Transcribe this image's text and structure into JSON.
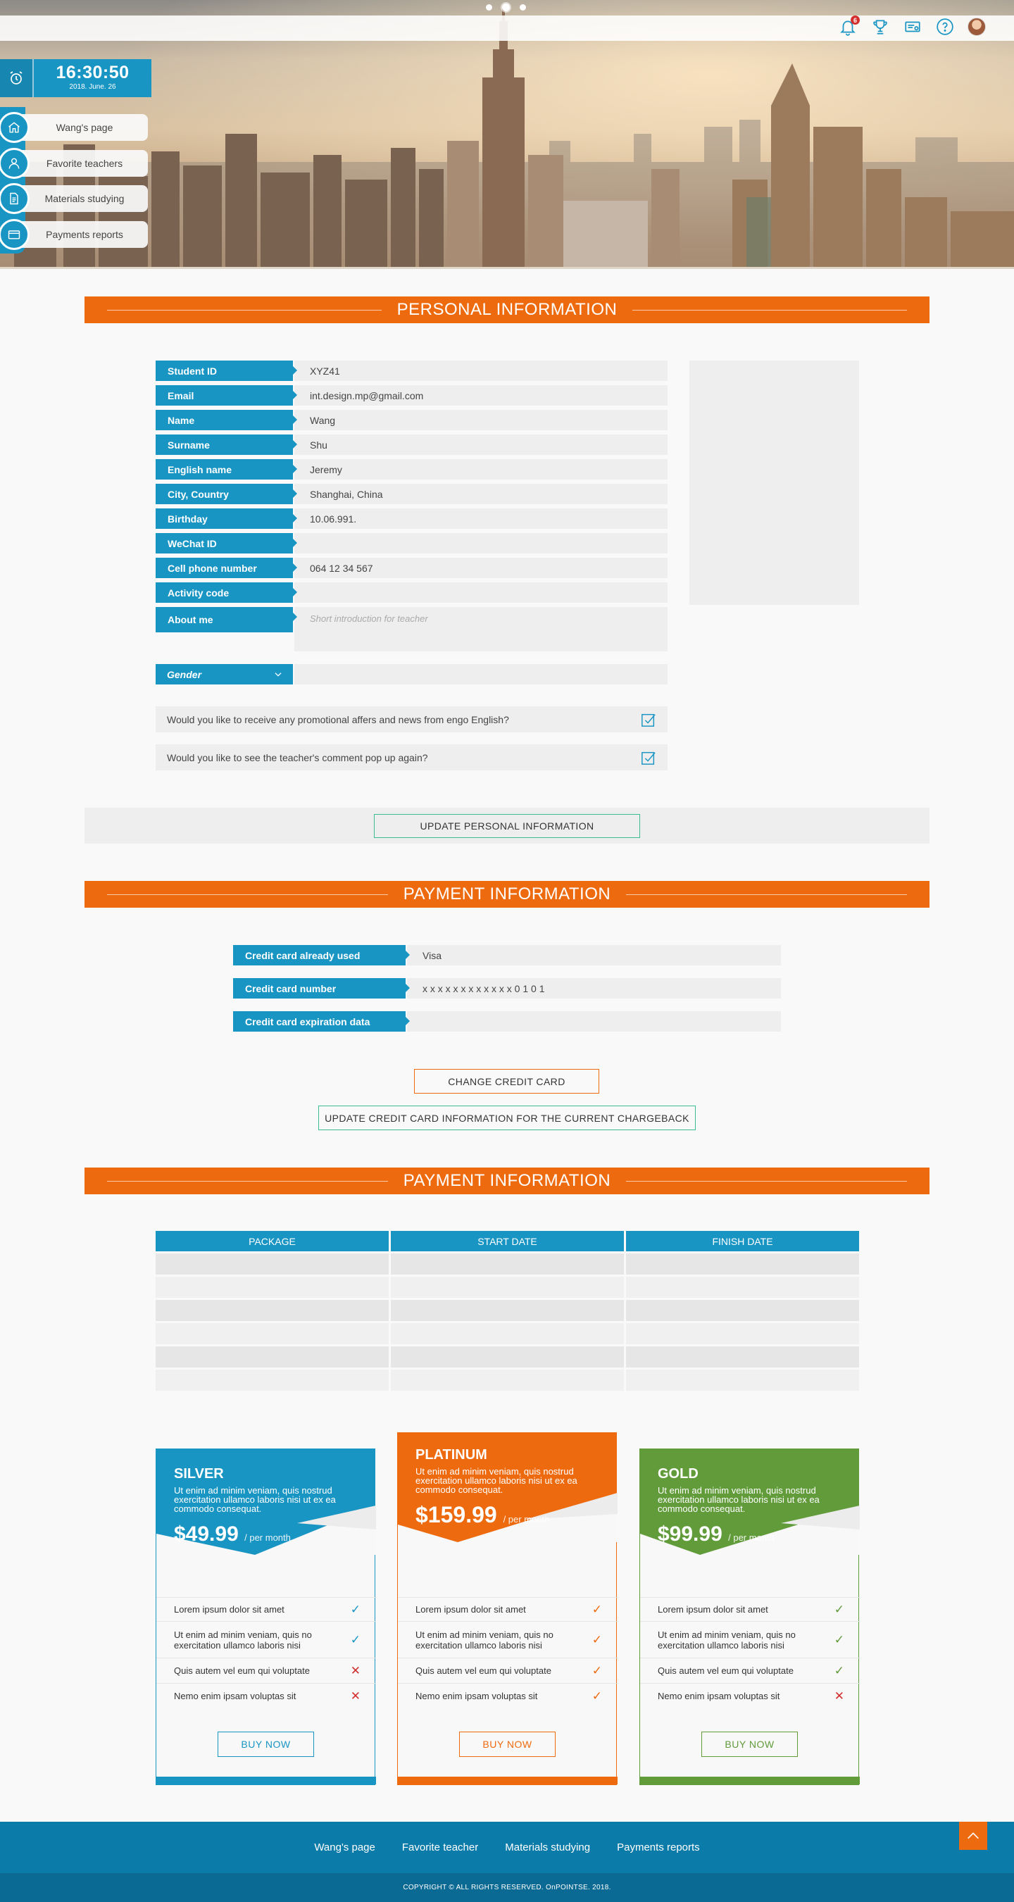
{
  "carousel": {
    "dot_count": 3,
    "active_index": 1
  },
  "header": {
    "notifications_count": "6",
    "icons": [
      "bell-icon",
      "trophy-icon",
      "certificate-icon",
      "help-icon",
      "avatar"
    ]
  },
  "clock": {
    "time": "16:30:50",
    "date": "2018. June. 26"
  },
  "sidebar": {
    "items": [
      {
        "label": "Wang's page",
        "icon": "home-icon"
      },
      {
        "label": "Favorite teachers",
        "icon": "user-icon"
      },
      {
        "label": "Materials studying",
        "icon": "document-icon"
      },
      {
        "label": "Payments reports",
        "icon": "credit-card-icon"
      }
    ]
  },
  "personal": {
    "title": "PERSONAL INFORMATION",
    "fields": [
      {
        "label": "Student ID",
        "value": "XYZ41"
      },
      {
        "label": "Email",
        "value": "int.design.mp@gmail.com"
      },
      {
        "label": "Name",
        "value": "Wang"
      },
      {
        "label": "Surname",
        "value": "Shu"
      },
      {
        "label": "English name",
        "value": "Jeremy"
      },
      {
        "label": "City, Country",
        "value": "Shanghai, China"
      },
      {
        "label": "Birthday",
        "value": "10.06.991."
      },
      {
        "label": "WeChat ID",
        "value": ""
      },
      {
        "label": "Cell phone number",
        "value": "064 12 34 567"
      },
      {
        "label": "Activity code",
        "value": ""
      },
      {
        "label": "About me",
        "placeholder": "Short introduction for teacher"
      }
    ],
    "gender_label": "Gender",
    "checks": [
      {
        "text": "Would you like to receive any promotional affers and news from engo English?",
        "checked": true
      },
      {
        "text": "Would you like to see the teacher's comment pop up again?",
        "checked": true
      }
    ],
    "update_button": "UPDATE PERSONAL INFORMATION"
  },
  "payment": {
    "title": "PAYMENT INFORMATION",
    "fields": [
      {
        "label": "Credit card already used",
        "value": "Visa"
      },
      {
        "label": "Credit card number",
        "value": "x x x x x x x x x x x x 0 1 0 1"
      },
      {
        "label": "Credit card expiration data",
        "value": ""
      }
    ],
    "change_button": "CHANGE CREDIT CARD",
    "update_button": "UPDATE CREDIT CARD INFORMATION FOR THE CURRENT CHARGEBACK"
  },
  "history": {
    "title": "PAYMENT INFORMATION",
    "columns": [
      "PACKAGE",
      "START DATE",
      "FINISH DATE"
    ],
    "rows": [
      [
        "",
        "",
        ""
      ],
      [
        "",
        "",
        ""
      ],
      [
        "",
        "",
        ""
      ],
      [
        "",
        "",
        ""
      ],
      [
        "",
        "",
        ""
      ],
      [
        "",
        "",
        ""
      ]
    ]
  },
  "plans": [
    {
      "name": "SILVER",
      "color": "#1995c4",
      "desc": "Ut enim ad minim veniam, quis nostrud exercitation ullamco laboris nisi ut ex ea commodo consequat.",
      "price": "$49.99",
      "per": "/ per month",
      "features": [
        {
          "text": "Lorem ipsum dolor sit amet",
          "included": true
        },
        {
          "text": "Ut enim ad minim veniam, quis no exercitation ullamco laboris nisi",
          "included": true
        },
        {
          "text": "Quis autem vel eum qui voluptate",
          "included": false
        },
        {
          "text": "Nemo enim ipsam voluptas sit",
          "included": false
        }
      ],
      "button": "BUY NOW"
    },
    {
      "name": "PLATINUM",
      "color": "#ee6a0f",
      "desc": "Ut enim ad minim veniam, quis nostrud exercitation ullamco laboris nisi ut ex ea commodo consequat.",
      "price": "$159.99",
      "per": "/ per month",
      "features": [
        {
          "text": "Lorem ipsum dolor sit amet",
          "included": true
        },
        {
          "text": "Ut enim ad minim veniam, quis no exercitation ullamco laboris nisi",
          "included": true
        },
        {
          "text": "Quis autem vel eum qui voluptate",
          "included": true
        },
        {
          "text": "Nemo enim ipsam voluptas sit",
          "included": true
        }
      ],
      "button": "BUY NOW"
    },
    {
      "name": "GOLD",
      "color": "#619b3a",
      "desc": "Ut enim ad minim veniam, quis nostrud exercitation ullamco laboris nisi ut ex ea commodo consequat.",
      "price": "$99.99",
      "per": "/ per month",
      "features": [
        {
          "text": "Lorem ipsum dolor sit amet",
          "included": true
        },
        {
          "text": "Ut enim ad minim veniam, quis no exercitation ullamco laboris nisi",
          "included": true
        },
        {
          "text": "Quis autem vel eum qui voluptate",
          "included": true
        },
        {
          "text": "Nemo enim ipsam voluptas sit",
          "included": false
        }
      ],
      "button": "BUY NOW"
    }
  ],
  "footer": {
    "links": [
      "Wang's page",
      "Favorite teacher",
      "Materials studying",
      "Payments reports"
    ],
    "copyright": "COPYRIGHT © ALL RIGHTS RESERVED. OnPOINTSE. 2018."
  },
  "colors": {
    "primary": "#1995c4",
    "accent": "#ee6a0f",
    "success": "#3dbb94",
    "footer": "#0b7baa",
    "danger": "#d32f2f"
  }
}
